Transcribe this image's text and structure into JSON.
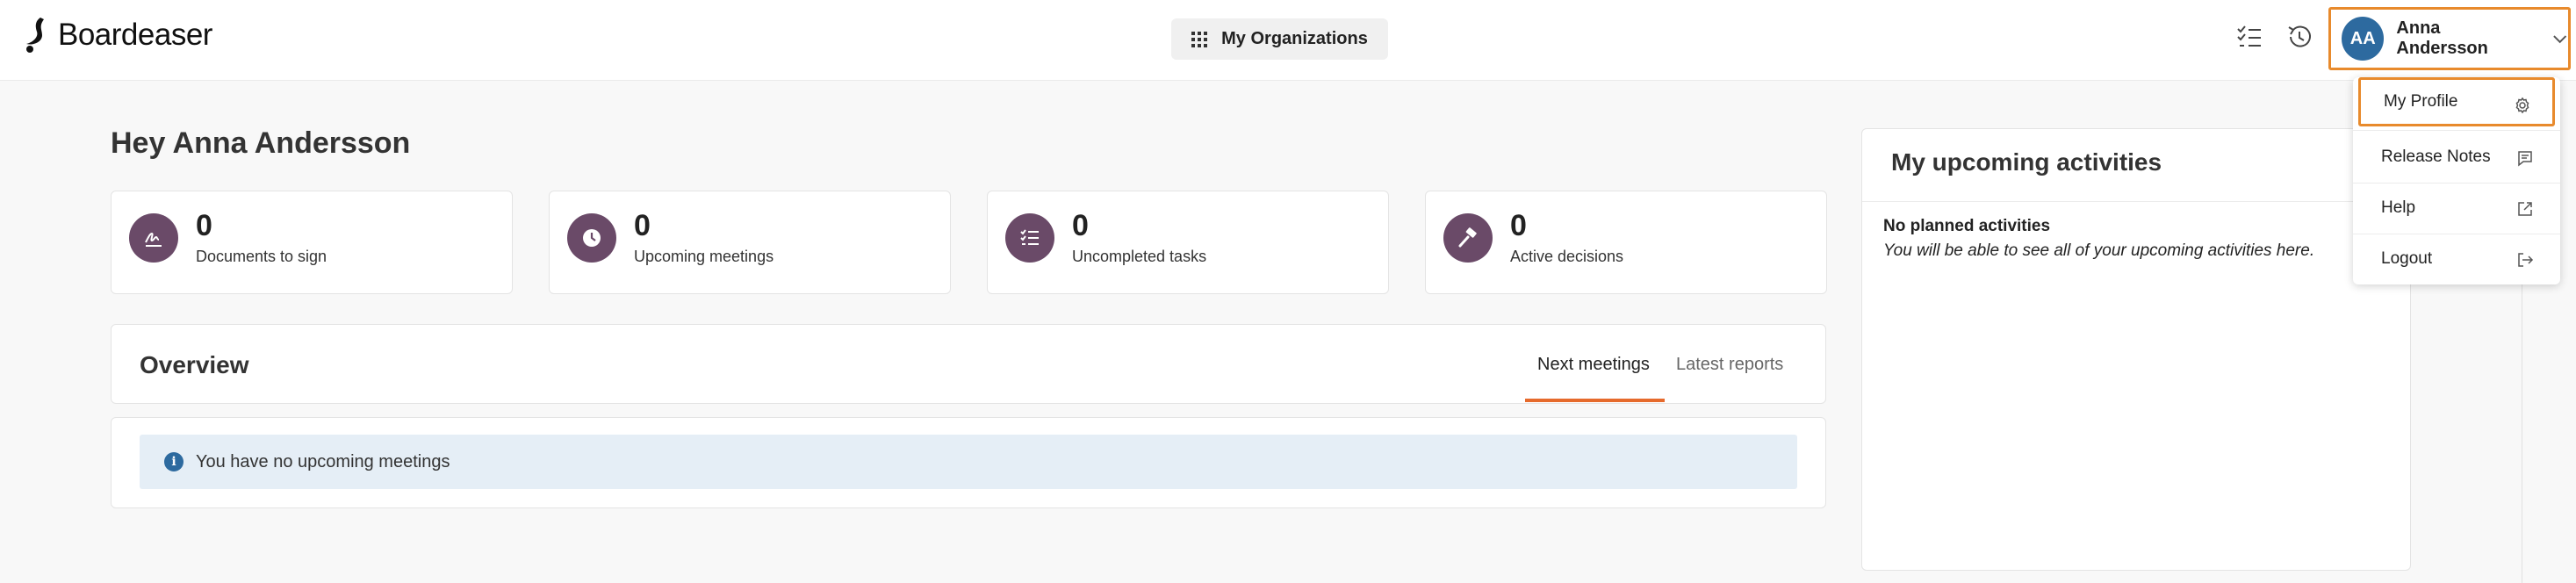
{
  "brand": {
    "name": "Boardeaser",
    "accent": "#e66a2c",
    "highlight": "#e88a2c",
    "stat_icon_bg": "#6a4a68",
    "avatar_bg": "#2d6a9f"
  },
  "header": {
    "org_button_label": "My Organizations",
    "user": {
      "initials": "AA",
      "name": "Anna Andersson"
    },
    "icons": [
      "task-list-icon",
      "history-icon"
    ]
  },
  "greeting": "Hey Anna Andersson",
  "stats": [
    {
      "value": "0",
      "label": "Documents to sign",
      "icon": "signature-icon"
    },
    {
      "value": "0",
      "label": "Upcoming meetings",
      "icon": "clock-icon"
    },
    {
      "value": "0",
      "label": "Uncompleted tasks",
      "icon": "checklist-icon"
    },
    {
      "value": "0",
      "label": "Active decisions",
      "icon": "gavel-icon"
    }
  ],
  "overview": {
    "title": "Overview",
    "tabs": [
      {
        "label": "Next meetings",
        "active": true
      },
      {
        "label": "Latest reports",
        "active": false
      }
    ],
    "empty_message": "You have no upcoming meetings"
  },
  "activities": {
    "title": "My upcoming activities",
    "empty_title": "No planned activities",
    "empty_text": "You will be able to see all of your upcoming activities here."
  },
  "user_menu": {
    "items": [
      {
        "label": "My Profile",
        "icon": "gear-icon",
        "highlighted": true
      },
      {
        "label": "Release Notes",
        "icon": "message-icon"
      },
      {
        "label": "Help",
        "icon": "external-link-icon"
      },
      {
        "label": "Logout",
        "icon": "logout-icon"
      }
    ]
  }
}
